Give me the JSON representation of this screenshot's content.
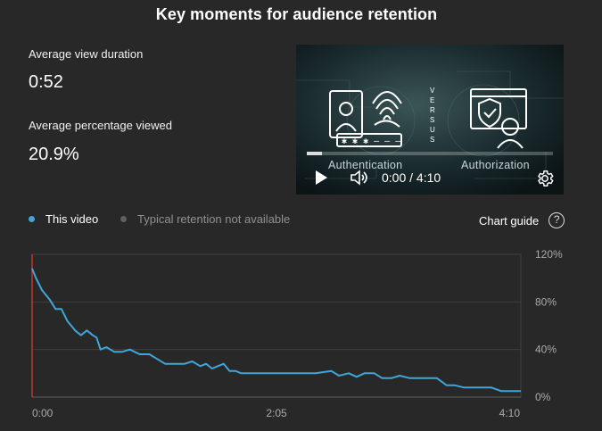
{
  "header": {
    "title": "Key moments for audience retention"
  },
  "metrics": [
    {
      "label": "Average view duration",
      "value": "0:52"
    },
    {
      "label": "Average percentage viewed",
      "value": "20.9%"
    }
  ],
  "player": {
    "time": "0:00 / 4:10",
    "thumbnail_left_caption": "Authentication",
    "thumbnail_right_caption": "Authorization",
    "thumbnail_versus": "VERSUS",
    "progress_fraction": 0.06
  },
  "legend": {
    "this_video": "This video",
    "typical": "Typical retention not available",
    "this_video_color": "#3ea6d8",
    "typical_color": "#606060"
  },
  "chart_guide": {
    "label": "Chart guide",
    "icon": "help-icon"
  },
  "chart_data": {
    "type": "line",
    "xlabel": "",
    "ylabel": "",
    "x_ticks": [
      "0:00",
      "2:05",
      "4:10"
    ],
    "y_ticks": [
      "120%",
      "80%",
      "40%",
      "0%"
    ],
    "xlim": [
      0,
      250
    ],
    "ylim": [
      0,
      120
    ],
    "grid": true,
    "series": [
      {
        "color": "#3ea6d8",
        "x": [
          0,
          2,
          5,
          9,
          12,
          15,
          18,
          22,
          25,
          28,
          31,
          33,
          35,
          38,
          42,
          46,
          50,
          55,
          60,
          64,
          68,
          73,
          78,
          82,
          86,
          89,
          92,
          95,
          98,
          101,
          104,
          107,
          110,
          116,
          125,
          135,
          145,
          153,
          157,
          162,
          166,
          170,
          175,
          179,
          184,
          188,
          193,
          197,
          202,
          207,
          212,
          216,
          221,
          226,
          230,
          235,
          240,
          245,
          250
        ],
        "y": [
          108,
          100,
          90,
          82,
          74,
          74,
          64,
          56,
          52,
          56,
          52,
          50,
          40,
          42,
          38,
          38,
          40,
          36,
          36,
          32,
          28,
          28,
          28,
          30,
          26,
          28,
          24,
          26,
          28,
          22,
          22,
          20,
          20,
          20,
          20,
          20,
          20,
          22,
          18,
          20,
          17,
          20,
          20,
          16,
          16,
          18,
          16,
          16,
          16,
          16,
          10,
          10,
          8,
          8,
          8,
          8,
          5,
          5,
          5
        ]
      }
    ]
  }
}
